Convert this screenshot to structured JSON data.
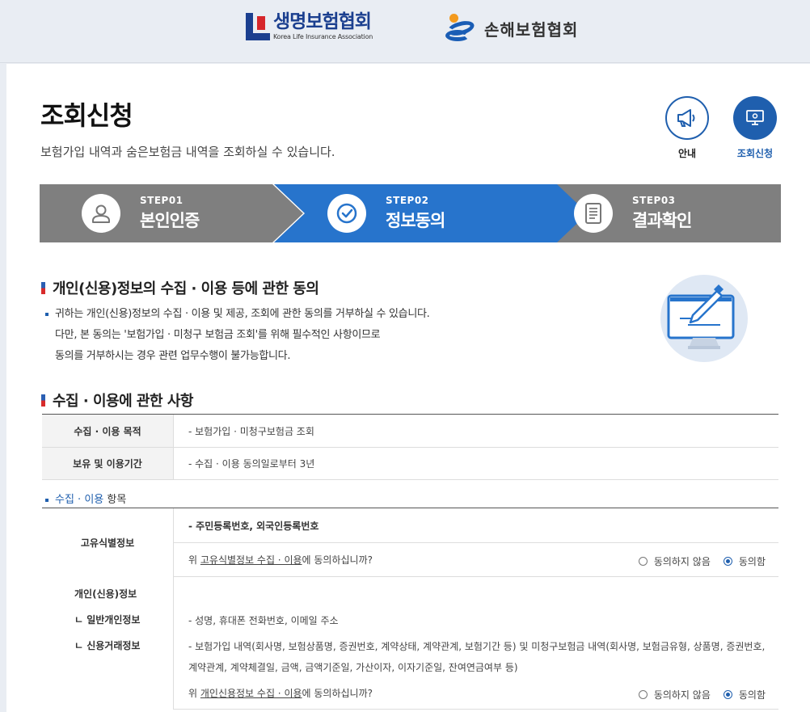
{
  "header": {
    "logo1": {
      "korean": "생명보험협회",
      "english": "Korea Life Insurance Association"
    },
    "logo2": {
      "korean": "손해보험협회"
    }
  },
  "page": {
    "title": "조회신청",
    "subtitle": "보험가입 내역과 숨은보험금 내역을 조회하실 수 있습니다."
  },
  "shortcuts": [
    {
      "label": "안내",
      "icon": "megaphone-icon"
    },
    {
      "label": "조회신청",
      "icon": "monitor-icon"
    }
  ],
  "steps": [
    {
      "num": "STEP01",
      "name": "본인인증",
      "icon": "user-icon",
      "active": false
    },
    {
      "num": "STEP02",
      "name": "정보동의",
      "icon": "check-icon",
      "active": true
    },
    {
      "num": "STEP03",
      "name": "결과확인",
      "icon": "document-icon",
      "active": false
    }
  ],
  "consent": {
    "title": "개인(신용)정보의 수집 · 이용 등에 관한 동의",
    "lines": [
      "귀하는 개인(신용)정보의 수집 · 이용 및 제공, 조회에 관한 동의를 거부하실 수 있습니다.",
      "다만, 본 동의는 '보험가입 · 미청구 보험금 조회'를 위해 필수적인 사항이므로",
      "동의를 거부하시는 경우 관련 업무수행이 불가능합니다."
    ]
  },
  "collection": {
    "title": "수집 · 이용에 관한 사항",
    "rows": [
      {
        "label": "수집 · 이용 목적",
        "value": "- 보험가입 · 미청구보험금 조회"
      },
      {
        "label": "보유 및 이용기간",
        "value": "- 수집 · 이용 동의일로부터 3년"
      }
    ],
    "items_label_blue": "수집 · 이용",
    "items_label_rest": " 항목"
  },
  "items": [
    {
      "label": "고유식별정보",
      "value": "- 주민등록번호, 외국인등록번호",
      "question_pre": "위 ",
      "question_link": "고유식별정보 수집 · 이용",
      "question_post": "에 동의하십니까?",
      "disagree": "동의하지 않음",
      "agree": "동의함",
      "selected": "agree"
    },
    {
      "label": "개인(신용)정보",
      "sub1": "ㄴ 일반개인정보",
      "sub2": "ㄴ 신용거래정보",
      "value1": "- 성명, 휴대폰 전화번호, 이메일 주소",
      "value2a": "- 보험가입 내역(회사명, 보험상품명, 증권번호, 계약상태, 계약관계, 보험기간 등) 및 미청구보험금 내역(회사명, 보험금유형, 상품명, 증권번호,",
      "value2b": "계약관계, 계약체결일, 금액, 금액기준일, 가산이자, 이자기준일, 잔여연금여부 등)",
      "question_pre": "위 ",
      "question_link": "개인신용정보 수집 · 이용",
      "question_post": "에 동의하십니까?",
      "disagree": "동의하지 않음",
      "agree": "동의함",
      "selected": "agree"
    }
  ],
  "colors": {
    "brand_blue": "#1f5fae",
    "step_active": "#2774cc",
    "step_inactive": "#7f7f7f"
  }
}
